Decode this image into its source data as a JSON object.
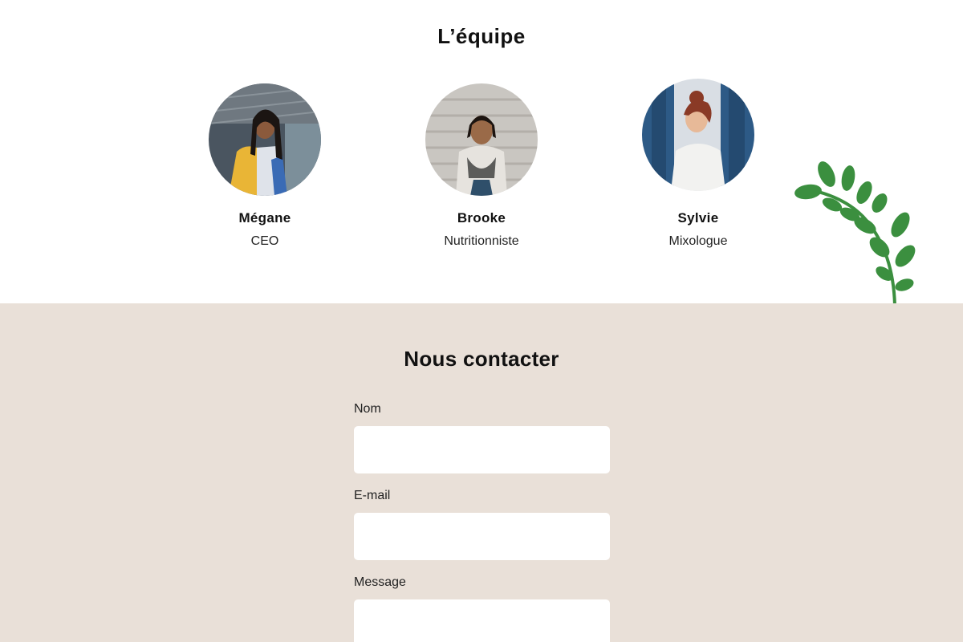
{
  "team": {
    "title": "L’équipe",
    "members": [
      {
        "name": "Mégane",
        "role": "CEO"
      },
      {
        "name": "Brooke",
        "role": "Nutritionniste"
      },
      {
        "name": "Sylvie",
        "role": "Mixologue"
      }
    ]
  },
  "contact": {
    "title": "Nous contacter",
    "fields": [
      {
        "label": "Nom",
        "value": ""
      },
      {
        "label": "E-mail",
        "value": ""
      },
      {
        "label": "Message",
        "value": ""
      }
    ]
  },
  "colors": {
    "contact_background": "#e9e0d8",
    "leaf_green": "#3b8f3f",
    "input_background": "#ffffff"
  }
}
